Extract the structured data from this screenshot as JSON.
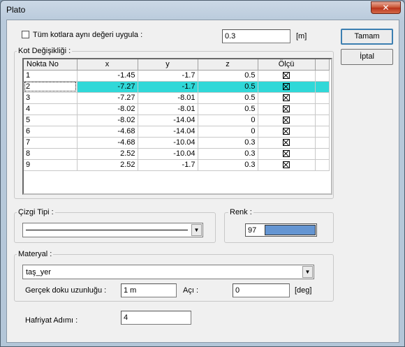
{
  "window": {
    "title": "Plato",
    "close_glyph": "✕"
  },
  "top": {
    "same_height_label": "Tüm kotlara aynı değeri uygula :",
    "same_height_checked": false,
    "height_value": "0.3",
    "height_unit": "[m]"
  },
  "buttons": {
    "ok": "Tamam",
    "cancel": "İptal"
  },
  "kot": {
    "group_label": "Kot Değişikliği :",
    "columns": [
      "Nokta No",
      "x",
      "y",
      "z",
      "Ölçü"
    ],
    "selected_row": 1,
    "rows": [
      {
        "no": "1",
        "x": "-1.45",
        "y": "-1.7",
        "z": "0.5",
        "olcu": true
      },
      {
        "no": "2",
        "x": "-7.27",
        "y": "-1.7",
        "z": "0.5",
        "olcu": true
      },
      {
        "no": "3",
        "x": "-7.27",
        "y": "-8.01",
        "z": "0.5",
        "olcu": true
      },
      {
        "no": "4",
        "x": "-8.02",
        "y": "-8.01",
        "z": "0.5",
        "olcu": true
      },
      {
        "no": "5",
        "x": "-8.02",
        "y": "-14.04",
        "z": "0",
        "olcu": true
      },
      {
        "no": "6",
        "x": "-4.68",
        "y": "-14.04",
        "z": "0",
        "olcu": true
      },
      {
        "no": "7",
        "x": "-4.68",
        "y": "-10.04",
        "z": "0.3",
        "olcu": true
      },
      {
        "no": "8",
        "x": "2.52",
        "y": "-10.04",
        "z": "0.3",
        "olcu": true
      },
      {
        "no": "9",
        "x": "2.52",
        "y": "-1.7",
        "z": "0.3",
        "olcu": true
      }
    ]
  },
  "line_type": {
    "group_label": "Çizgi Tipi :",
    "icon": "solid-line"
  },
  "color": {
    "group_label": "Renk :",
    "value": "97",
    "swatch": "#6495d2"
  },
  "material": {
    "group_label": "Materyal :",
    "selected": "taş_yer",
    "texture_length_label": "Gerçek doku uzunluğu :",
    "texture_length_value": "1 m",
    "angle_label": "Açı :",
    "angle_value": "0",
    "angle_unit": "[deg]"
  },
  "excavation": {
    "label": "Hafriyat Adımı :",
    "value": "4"
  }
}
